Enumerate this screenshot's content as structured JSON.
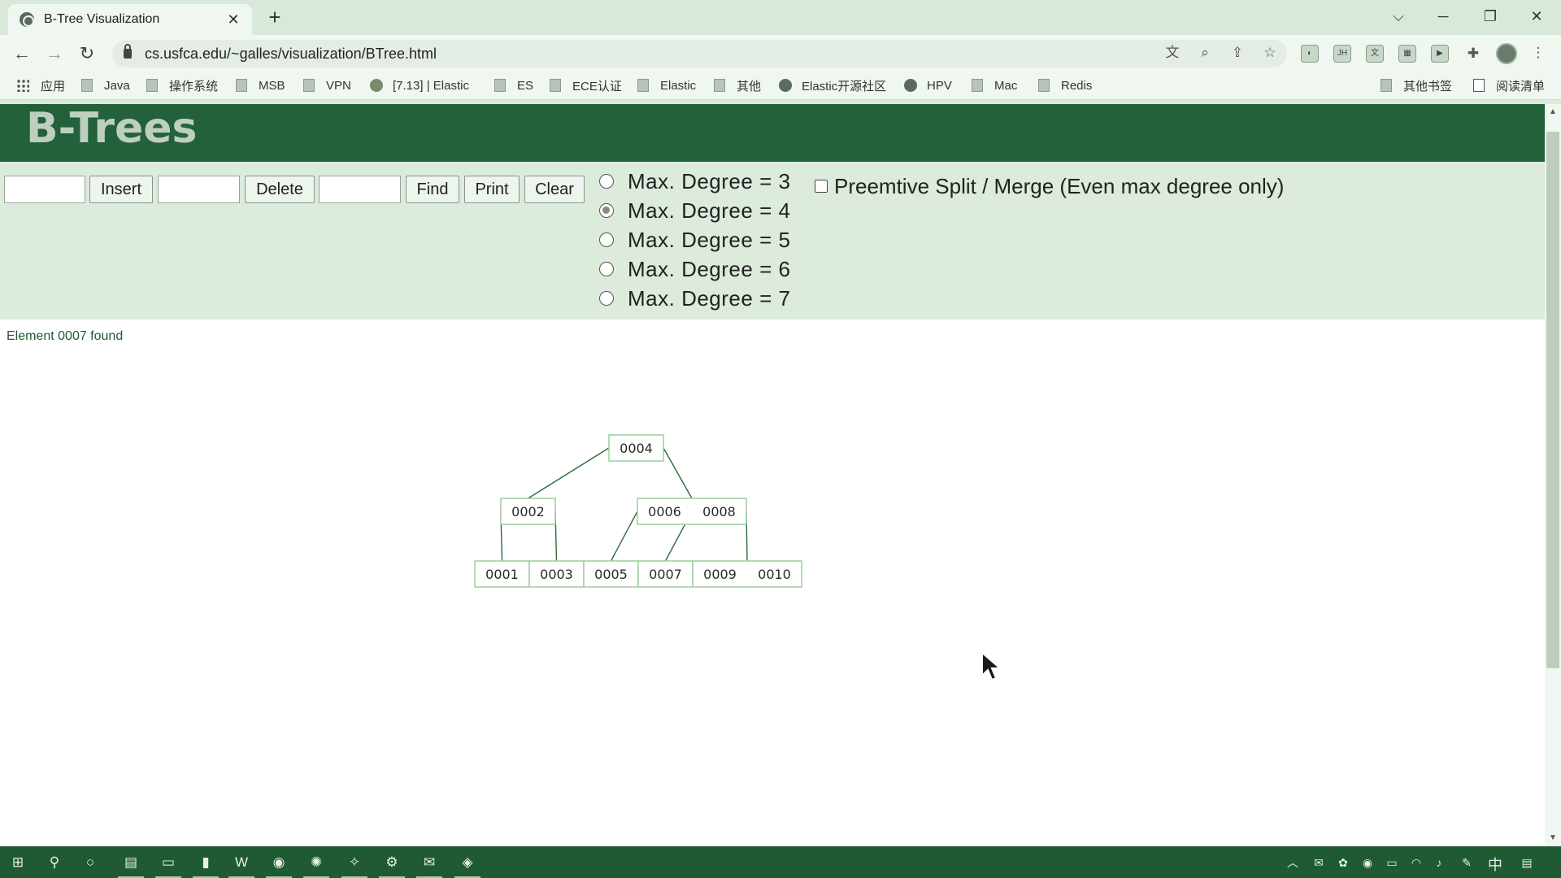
{
  "browser": {
    "tab_title": "B-Tree Visualization",
    "url": "cs.usfca.edu/~galles/visualization/BTree.html",
    "bookmarks": [
      {
        "label": "应用",
        "icon": "apps-grid-icon"
      },
      {
        "label": "Java",
        "icon": "folder-icon"
      },
      {
        "label": "操作系统",
        "icon": "folder-icon"
      },
      {
        "label": "MSB",
        "icon": "folder-icon"
      },
      {
        "label": "VPN",
        "icon": "folder-icon"
      },
      {
        "label": "[7.13] | Elastic",
        "icon": "elastic-icon"
      },
      {
        "label": "ES",
        "icon": "folder-icon"
      },
      {
        "label": "ECE认证",
        "icon": "folder-icon"
      },
      {
        "label": "Elastic",
        "icon": "folder-icon"
      },
      {
        "label": "其他",
        "icon": "folder-icon"
      },
      {
        "label": "Elastic开源社区",
        "icon": "globe-icon"
      },
      {
        "label": "HPV",
        "icon": "globe-icon"
      },
      {
        "label": "Mac",
        "icon": "folder-icon"
      },
      {
        "label": "Redis",
        "icon": "folder-icon"
      }
    ],
    "other_bookmarks": "其他书签",
    "reading_list": "阅读清单",
    "ext_jh": "JH"
  },
  "page": {
    "title": "B-Trees",
    "controls": {
      "insert_label": "Insert",
      "delete_label": "Delete",
      "find_label": "Find",
      "print_label": "Print",
      "clear_label": "Clear",
      "degree_options": [
        "Max. Degree = 3",
        "Max. Degree = 4",
        "Max. Degree = 5",
        "Max. Degree = 6",
        "Max. Degree = 7"
      ],
      "selected_degree": 4,
      "preemptive_label": "Preemtive Split / Merge (Even max degree only)",
      "preemptive_checked": false
    },
    "status": "Element 0007 found",
    "tree": {
      "root": [
        "0004"
      ],
      "level1": [
        [
          "0002"
        ],
        [
          "0006",
          "0008"
        ]
      ],
      "leaves": [
        [
          "0001"
        ],
        [
          "0003"
        ],
        [
          "0005"
        ],
        [
          "0007"
        ],
        [
          "0009",
          "0010"
        ]
      ]
    }
  },
  "taskbar": {
    "ime": "中"
  },
  "colors": {
    "header_bg": "#22613a",
    "controls_bg": "#dcebdc",
    "tree_node_border": "#9ccf9c",
    "tree_edge": "#2e6b3a"
  }
}
